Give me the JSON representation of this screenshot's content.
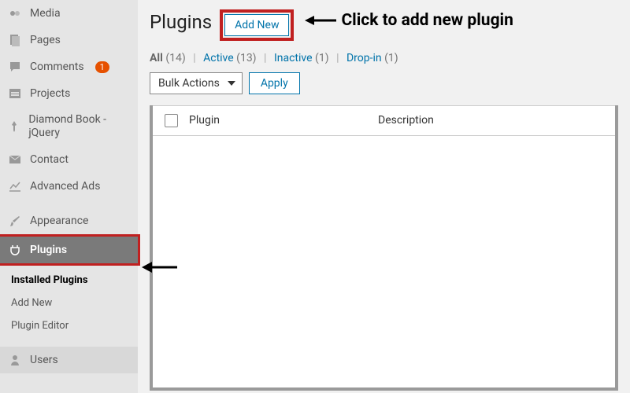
{
  "sidebar": {
    "items": [
      {
        "label": "Media"
      },
      {
        "label": "Pages"
      },
      {
        "label": "Comments",
        "badge": "1"
      },
      {
        "label": "Projects"
      },
      {
        "label": "Diamond Book - jQuery"
      },
      {
        "label": "Contact"
      },
      {
        "label": "Advanced Ads"
      },
      {
        "label": "Appearance"
      },
      {
        "label": "Plugins"
      },
      {
        "label": "Users"
      }
    ],
    "submenu": [
      {
        "label": "Installed Plugins"
      },
      {
        "label": "Add New"
      },
      {
        "label": "Plugin Editor"
      }
    ]
  },
  "page": {
    "title": "Plugins",
    "add_new": "Add New",
    "annotation": "Click to add new plugin"
  },
  "filters": {
    "all_label": "All",
    "all_count": "(14)",
    "active_label": "Active",
    "active_count": "(13)",
    "inactive_label": "Inactive",
    "inactive_count": "(1)",
    "dropin_label": "Drop-in",
    "dropin_count": "(1)"
  },
  "actions": {
    "bulk": "Bulk Actions",
    "apply": "Apply"
  },
  "table": {
    "col_plugin": "Plugin",
    "col_desc": "Description"
  }
}
